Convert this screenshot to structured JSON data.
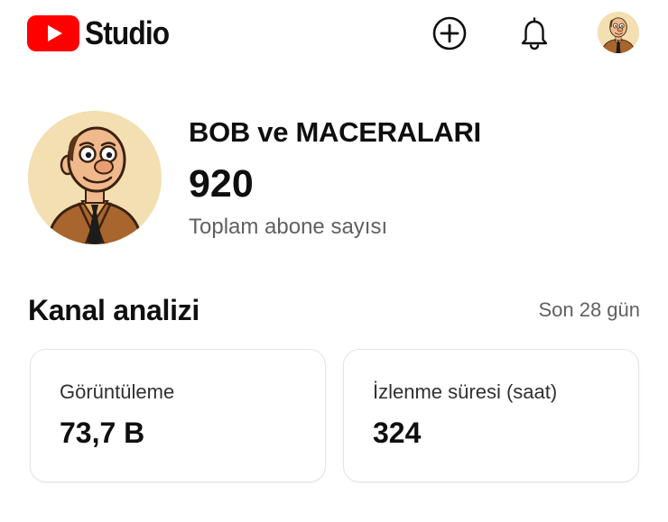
{
  "header": {
    "logo_text": "Studio",
    "brand_color": "#ff0000",
    "icons": [
      "create-plus-icon",
      "notifications-bell-icon"
    ]
  },
  "channel": {
    "name": "BOB ve MACERALARI",
    "subscriber_count": "920",
    "subscriber_label": "Toplam abone sayısı"
  },
  "analytics": {
    "title": "Kanal analizi",
    "period": "Son 28 gün",
    "cards": [
      {
        "label": "Görüntüleme",
        "value": "73,7 B"
      },
      {
        "label": "İzlenme süresi (saat)",
        "value": "324"
      }
    ]
  }
}
